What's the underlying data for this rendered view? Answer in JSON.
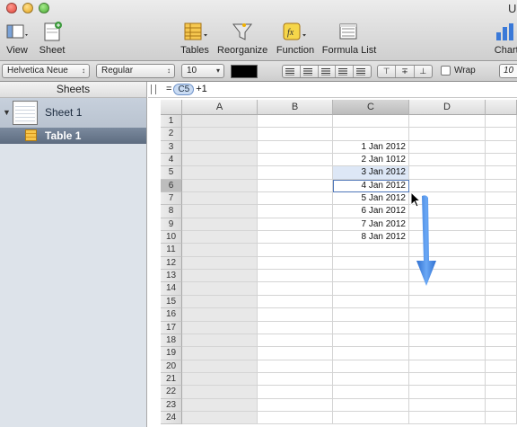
{
  "window": {
    "title": "U"
  },
  "toolbar": {
    "view": "View",
    "sheet": "Sheet",
    "tables": "Tables",
    "reorganize": "Reorganize",
    "function": "Function",
    "formula_list": "Formula List",
    "charts": "Charts"
  },
  "format_bar": {
    "font_family": "Helvetica Neue",
    "font_style": "Regular",
    "font_size": "10",
    "text_color": "#000000",
    "wrap_label": "Wrap",
    "wrap_checked": false,
    "number_field": "10"
  },
  "sidebar": {
    "header": "Sheets",
    "sheet_name": "Sheet 1",
    "table_name": "Table 1"
  },
  "formula_bar": {
    "prefix": "=",
    "cell_ref": "C5",
    "suffix": "+1"
  },
  "grid": {
    "columns": [
      "A",
      "B",
      "C",
      "D"
    ],
    "selected_column": "C",
    "row_numbers": [
      "1",
      "2",
      "3",
      "4",
      "5",
      "6",
      "7",
      "8",
      "9",
      "10",
      "11",
      "12",
      "13",
      "14",
      "15",
      "16",
      "17",
      "18",
      "19",
      "20",
      "21",
      "22",
      "23",
      "24"
    ],
    "column_c_values": [
      "",
      "",
      "1 Jan 2012",
      "2 Jan 1012",
      "3 Jan 2012",
      "4 Jan 2012",
      "5 Jan 2012",
      "6 Jan 2012",
      "7 Jan 2012",
      "8 Jan 2012"
    ],
    "active_row": "6",
    "referenced_row": "5"
  },
  "colors": {
    "accent": "#4f77b9",
    "arrow": "#3a84e6"
  }
}
